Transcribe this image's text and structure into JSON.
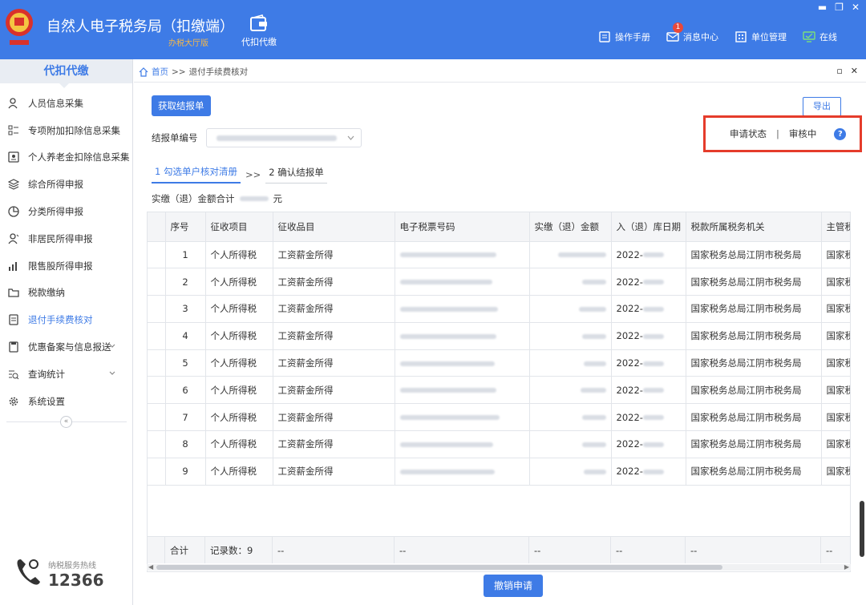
{
  "app": {
    "title": "自然人电子税务局（扣缴端）",
    "subtitle": "办税大厅版",
    "module": "代扣代缴",
    "brand_color": "#3e7be6",
    "top_links": [
      {
        "icon": "manual-icon",
        "label": "操作手册"
      },
      {
        "icon": "message-icon",
        "label": "消息中心",
        "badge": "1"
      },
      {
        "icon": "building-icon",
        "label": "单位管理"
      },
      {
        "icon": "monitor-icon",
        "label": "在线"
      }
    ]
  },
  "sidebar": {
    "header": "代扣代缴",
    "items": [
      {
        "icon": "person-icon",
        "label": "人员信息采集"
      },
      {
        "icon": "grid-list-icon",
        "label": "专项附加扣除信息采集"
      },
      {
        "icon": "pension-icon",
        "label": "个人养老金扣除信息采集"
      },
      {
        "icon": "layers-icon",
        "label": "综合所得申报"
      },
      {
        "icon": "pie-icon",
        "label": "分类所得申报"
      },
      {
        "icon": "nonresident-icon",
        "label": "非居民所得申报"
      },
      {
        "icon": "bar-chart-icon",
        "label": "限售股所得申报"
      },
      {
        "icon": "folder-icon",
        "label": "税款缴纳"
      },
      {
        "icon": "document-check-icon",
        "label": "退付手续费核对",
        "active": true
      },
      {
        "icon": "document-icon",
        "label": "优惠备案与信息报送",
        "expandable": true
      },
      {
        "icon": "search-list-icon",
        "label": "查询统计",
        "expandable": true
      },
      {
        "icon": "gear-icon",
        "label": "系统设置"
      }
    ],
    "collapse_glyph": "«",
    "hotline_label": "纳税服务热线",
    "hotline_number": "12366"
  },
  "breadcrumb": {
    "home": "首页",
    "separator": ">>",
    "current": "退付手续费核对"
  },
  "toolbar": {
    "fetch_button": "获取结报单",
    "export_button": "导出"
  },
  "form": {
    "report_no_label": "结报单编号"
  },
  "status": {
    "label": "申请状态",
    "separator": "|",
    "value": "审核中",
    "help": "?"
  },
  "steps": [
    {
      "label": "1 勾选单户核对清册",
      "active": true
    },
    {
      "label": "2 确认结报单",
      "active": false
    }
  ],
  "step_arrow": ">>",
  "summary": {
    "label": "实缴（退）金额合计",
    "unit": "元"
  },
  "table": {
    "columns": [
      "序号",
      "征收项目",
      "征收品目",
      "电子税票号码",
      "实缴（退）金额",
      "入（退）库日期",
      "税款所属税务机关",
      "主管税"
    ],
    "rows": [
      {
        "no": "1",
        "item": "个人所得税",
        "category": "工资薪金所得",
        "date_prefix": "2022-",
        "office": "国家税务总局江阴市税务局",
        "office2": "国家税"
      },
      {
        "no": "2",
        "item": "个人所得税",
        "category": "工资薪金所得",
        "date_prefix": "2022-",
        "office": "国家税务总局江阴市税务局",
        "office2": "国家税"
      },
      {
        "no": "3",
        "item": "个人所得税",
        "category": "工资薪金所得",
        "date_prefix": "2022-",
        "office": "国家税务总局江阴市税务局",
        "office2": "国家税"
      },
      {
        "no": "4",
        "item": "个人所得税",
        "category": "工资薪金所得",
        "date_prefix": "2022-",
        "office": "国家税务总局江阴市税务局",
        "office2": "国家税"
      },
      {
        "no": "5",
        "item": "个人所得税",
        "category": "工资薪金所得",
        "date_prefix": "2022-",
        "office": "国家税务总局江阴市税务局",
        "office2": "国家税"
      },
      {
        "no": "6",
        "item": "个人所得税",
        "category": "工资薪金所得",
        "date_prefix": "2022-",
        "office": "国家税务总局江阴市税务局",
        "office2": "国家税"
      },
      {
        "no": "7",
        "item": "个人所得税",
        "category": "工资薪金所得",
        "date_prefix": "2022-",
        "office": "国家税务总局江阴市税务局",
        "office2": "国家税"
      },
      {
        "no": "8",
        "item": "个人所得税",
        "category": "工资薪金所得",
        "date_prefix": "2022-",
        "office": "国家税务总局江阴市税务局",
        "office2": "国家税"
      },
      {
        "no": "9",
        "item": "个人所得税",
        "category": "工资薪金所得",
        "date_prefix": "2022-",
        "office": "国家税务总局江阴市税务局",
        "office2": "国家税"
      }
    ],
    "footer": {
      "label": "合计",
      "record_count": "记录数：9",
      "placeholder": "--"
    }
  },
  "revoke_button": "撤销申请",
  "status_highlight_color": "#e53c2b"
}
